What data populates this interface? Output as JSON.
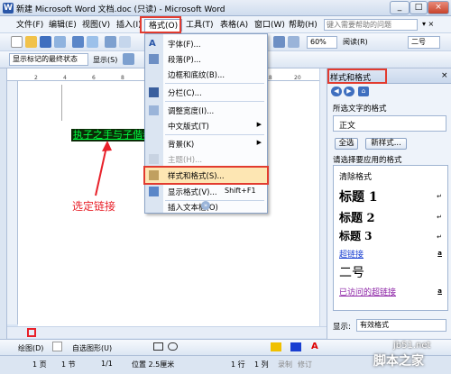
{
  "title": "新建 Microsoft Word 文档.doc (只读) - Microsoft Word",
  "app_icon": "W",
  "window_buttons": [
    "_",
    "□",
    "×"
  ],
  "menu": [
    "文件(F)",
    "编辑(E)",
    "视图(V)",
    "插入(I)",
    "格式(O)",
    "工具(T)",
    "表格(A)",
    "窗口(W)",
    "帮助(H)"
  ],
  "help_placeholder": "键入需要帮助的问题",
  "zoom": "60%",
  "read_label": "阅读(R)",
  "font_size": "二号",
  "view_mode": "显示标记的最终状态",
  "show_label": "显示(S)",
  "format_menu": [
    {
      "label": "字体(F)...",
      "icon": "font-icon"
    },
    {
      "label": "段落(P)...",
      "icon": "paragraph-icon"
    },
    {
      "label": "边框和底纹(B)...",
      "icon": ""
    },
    {
      "label": "分栏(C)...",
      "icon": "columns-icon"
    },
    {
      "label": "调整宽度(I)...",
      "icon": "width-icon"
    },
    {
      "label": "中文版式(T)",
      "icon": ""
    },
    {
      "label": "背景(K)",
      "icon": ""
    },
    {
      "label": "主题(H)...",
      "icon": "theme-icon"
    },
    {
      "label": "样式和格式(S)...",
      "icon": "styles-icon"
    },
    {
      "label": "显示格式(V)...",
      "icon": "reveal-icon",
      "shortcut": "Shift+F1"
    },
    {
      "label": "插入文本框(O)",
      "icon": ""
    }
  ],
  "doc": {
    "link_text": "执子之手与子偕老",
    "annotation": "选定链接"
  },
  "pane": {
    "title": "样式和格式",
    "selected_label": "所选文字的格式",
    "selected_value": "正文",
    "select_all": "全选",
    "new_style": "新样式...",
    "apply_label": "请选择要应用的格式",
    "styles": [
      {
        "name": "清除格式",
        "glyph": ""
      },
      {
        "name": "标题 1",
        "glyph": "↵"
      },
      {
        "name": "标题 2",
        "glyph": "↵"
      },
      {
        "name": "标题 3",
        "glyph": "↵"
      },
      {
        "name": "超链接",
        "glyph": "a"
      },
      {
        "name": "二号",
        "glyph": ""
      },
      {
        "name": "已访问的超链接",
        "glyph": "a"
      }
    ],
    "show_label": "显示:",
    "show_value": "有效格式"
  },
  "drawbar": {
    "draw": "绘图(D)",
    "autoshape": "自选图形(U)"
  },
  "status": {
    "page": "1 页",
    "section": "1 节",
    "pages": "1/1",
    "position": "位置 2.5厘米",
    "line": "1 行",
    "col": "1 列",
    "rec": "录制",
    "trk": "修订"
  },
  "watermark": {
    "site": "jb51.net",
    "brand": "脚本之家"
  },
  "colors": {
    "highlight": "#e23b2f",
    "link_text": "#00ff40",
    "link_bg": "#0a2b06",
    "annotation": "#e8212a"
  }
}
